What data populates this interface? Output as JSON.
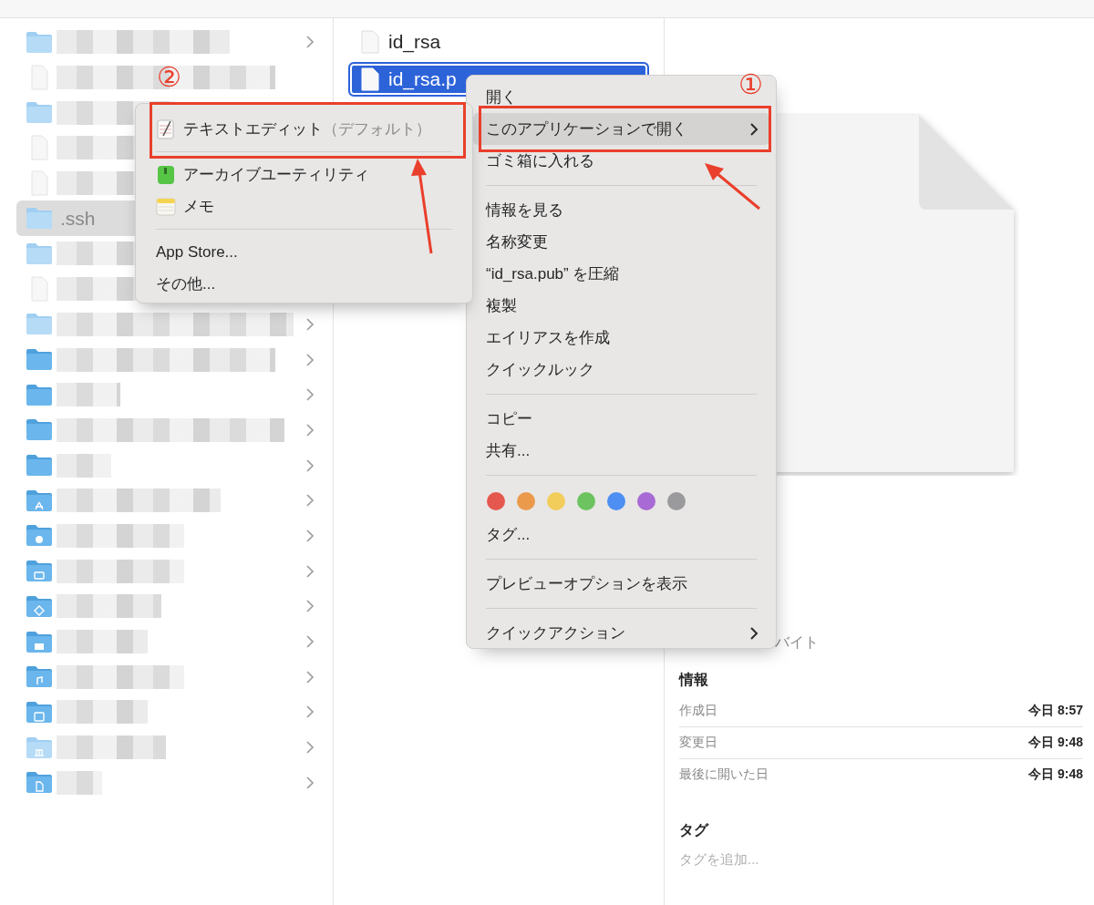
{
  "sidebar_column": {
    "items": [
      {
        "kind": "hidden_folder",
        "expandable": true,
        "selected": false
      },
      {
        "kind": "file",
        "selected": false
      },
      {
        "kind": "hidden_folder",
        "selected": false
      },
      {
        "kind": "file",
        "selected": false
      },
      {
        "kind": "file",
        "selected": false
      },
      {
        "kind": "hidden_folder",
        "label": ".ssh",
        "selected": true
      },
      {
        "kind": "hidden_folder",
        "selected": false
      },
      {
        "kind": "file",
        "selected": false
      },
      {
        "kind": "hidden_folder",
        "expandable": true,
        "selected": false
      },
      {
        "kind": "folder",
        "expandable": true,
        "selected": false
      },
      {
        "kind": "folder",
        "expandable": true,
        "selected": false
      },
      {
        "kind": "folder",
        "expandable": true,
        "selected": false
      },
      {
        "kind": "folder",
        "expandable": true,
        "selected": false
      },
      {
        "kind": "apps_folder",
        "expandable": true,
        "selected": false
      },
      {
        "kind": "downloads_folder",
        "expandable": true,
        "selected": false
      },
      {
        "kind": "desktop_folder",
        "expandable": true,
        "selected": false
      },
      {
        "kind": "cloud_folder",
        "expandable": true,
        "selected": false
      },
      {
        "kind": "pictures_folder",
        "expandable": true,
        "selected": false
      },
      {
        "kind": "music_folder",
        "expandable": true,
        "selected": false
      },
      {
        "kind": "movies_folder",
        "expandable": true,
        "selected": false
      },
      {
        "kind": "library_folder",
        "expandable": true,
        "selected": false
      },
      {
        "kind": "documents_folder",
        "expandable": true,
        "selected": false
      }
    ]
  },
  "file_column": {
    "items": [
      {
        "label": "id_rsa",
        "selected": false
      },
      {
        "label": "id_rsa.p",
        "selected": true
      }
    ]
  },
  "preview": {
    "size": "バイト",
    "info_heading": "情報",
    "info_rows": [
      {
        "label": "作成日",
        "value": "今日 8:57"
      },
      {
        "label": "変更日",
        "value": "今日 9:48"
      },
      {
        "label": "最後に開いた日",
        "value": "今日 9:48"
      }
    ],
    "tags_heading": "タグ",
    "tags_field": {
      "placeholder": "タグを追加..."
    }
  },
  "context_menu": {
    "items": [
      {
        "kind": "item",
        "label": "開く",
        "selected": false
      },
      {
        "kind": "item",
        "label": "このアプリケーションで開く",
        "submenu": true,
        "selected": true
      },
      {
        "kind": "item",
        "label": "ゴミ箱に入れる",
        "selected": false
      },
      {
        "kind": "separator"
      },
      {
        "kind": "item",
        "label": "情報を見る",
        "selected": false
      },
      {
        "kind": "item",
        "label": "名称変更",
        "selected": false
      },
      {
        "kind": "item",
        "label": "“id_rsa.pub” を圧縮",
        "selected": false
      },
      {
        "kind": "item",
        "label": "複製",
        "selected": false
      },
      {
        "kind": "item",
        "label": "エイリアスを作成",
        "selected": false
      },
      {
        "kind": "item",
        "label": "クイックルック",
        "selected": false
      },
      {
        "kind": "separator"
      },
      {
        "kind": "item",
        "label": "コピー",
        "selected": false
      },
      {
        "kind": "item",
        "label": "共有...",
        "selected": false
      },
      {
        "kind": "separator"
      },
      {
        "kind": "tag_colors",
        "dots": [
          {
            "color": "#e5584f"
          },
          {
            "color": "#eb9a4c"
          },
          {
            "color": "#f2cd5b"
          },
          {
            "color": "#6cc35f"
          },
          {
            "color": "#4d8ff2"
          },
          {
            "color": "#a86ad4"
          },
          {
            "color": "#9a9a9c"
          }
        ]
      },
      {
        "kind": "item",
        "label": "タグ...",
        "selected": false
      },
      {
        "kind": "separator"
      },
      {
        "kind": "item",
        "label": "プレビューオプションを表示",
        "selected": false
      },
      {
        "kind": "separator"
      },
      {
        "kind": "item",
        "label": "クイックアクション",
        "submenu": true,
        "selected": false
      }
    ]
  },
  "submenu": {
    "items": [
      {
        "kind": "textedit",
        "label": "テキストエディット",
        "suffix": "（デフォルト）"
      },
      {
        "kind": "separator"
      },
      {
        "kind": "archive",
        "label": "アーカイブユーティリティ"
      },
      {
        "kind": "notes",
        "label": "メモ"
      },
      {
        "kind": "separator"
      },
      {
        "kind": "item",
        "label": "App Store..."
      },
      {
        "kind": "item",
        "label": "その他..."
      }
    ]
  },
  "annotations": [
    {
      "label": "②"
    },
    {
      "label": "①"
    }
  ]
}
